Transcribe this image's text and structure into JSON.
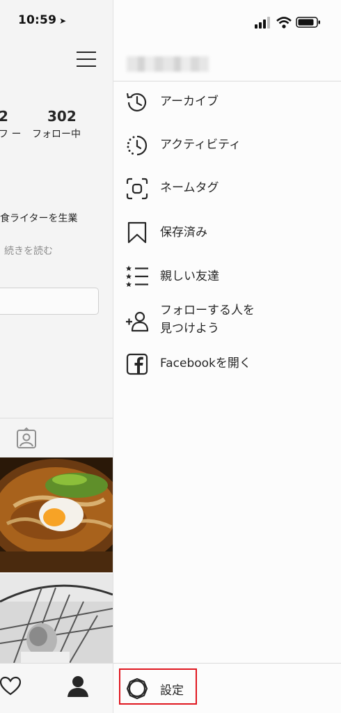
{
  "status_bar": {
    "time": "10:59",
    "location_arrow": "location-arrow-icon"
  },
  "profile": {
    "stats": [
      {
        "number": "2",
        "label": "フ ー"
      },
      {
        "number": "302",
        "label": "フォロー中"
      }
    ],
    "bio_line": "食ライターを生業",
    "read_more": "続きを読む"
  },
  "menu": {
    "items": [
      {
        "label": "アーカイブ",
        "icon": "archive-history-icon"
      },
      {
        "label": "アクティビティ",
        "icon": "activity-clock-icon"
      },
      {
        "label": "ネームタグ",
        "icon": "nametag-icon"
      },
      {
        "label": "保存済み",
        "icon": "bookmark-icon"
      },
      {
        "label": "親しい友達",
        "icon": "close-friends-list-icon"
      },
      {
        "label": "フォローする人を\n見つけよう",
        "label_line1": "フォローする人を",
        "label_line2": "見つけよう",
        "icon": "add-person-icon"
      },
      {
        "label": "Facebookを開く",
        "icon": "facebook-icon"
      }
    ],
    "settings_label": "設定"
  },
  "colors": {
    "highlight": "#e0161f",
    "text": "#262626",
    "muted": "#8e8e8e"
  }
}
